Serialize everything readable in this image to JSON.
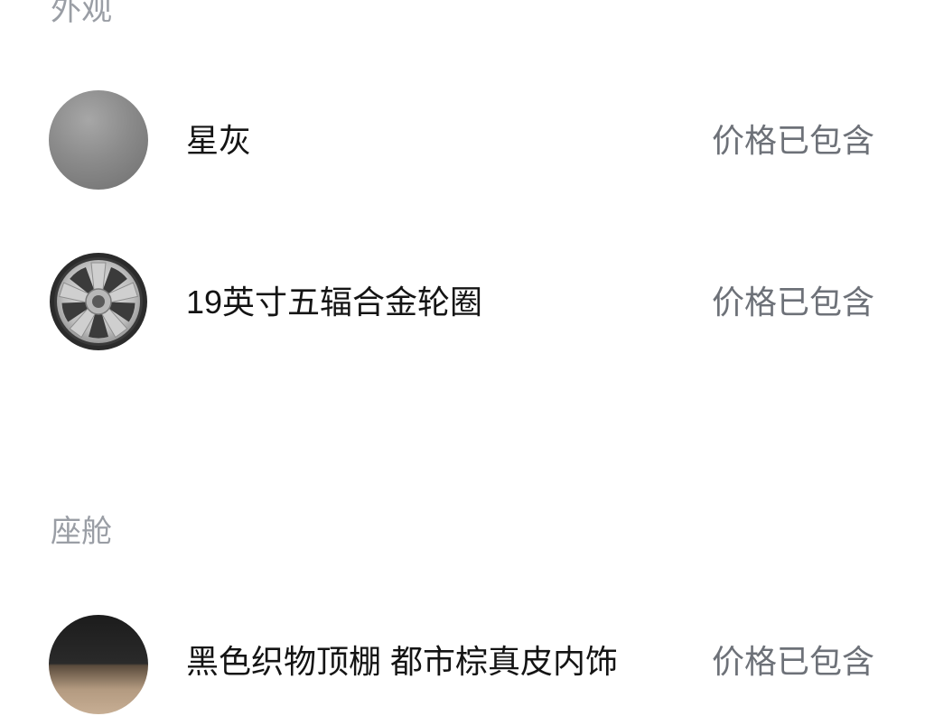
{
  "sections": {
    "exterior": {
      "title": "外观",
      "items": [
        {
          "name": "星灰",
          "price": "价格已包含",
          "swatch": "gray-color-swatch"
        },
        {
          "name": "19英寸五辐合金轮圈",
          "price": "价格已包含",
          "swatch": "alloy-wheel-icon"
        }
      ]
    },
    "cabin": {
      "title": "座舱",
      "items": [
        {
          "name": "黑色织物顶棚 都市棕真皮内饰",
          "price": "价格已包含",
          "swatch": "interior-color-swatch"
        }
      ]
    }
  },
  "colors": {
    "section_title": "#9a9ea5",
    "item_name": "#141414",
    "price": "#6d7178",
    "star_gray": "#8b8b8b",
    "cabin_black": "#1c1c1c",
    "cabin_brown": "#b39a80"
  }
}
